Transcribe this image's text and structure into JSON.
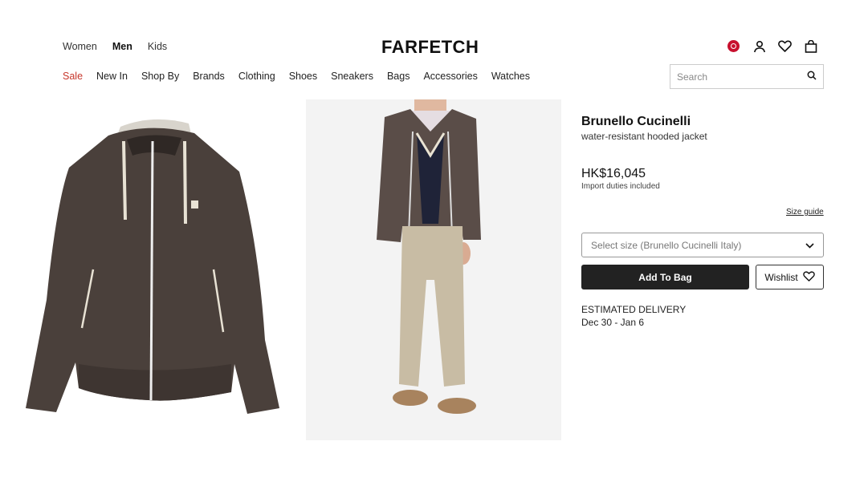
{
  "header": {
    "gender_tabs": [
      "Women",
      "Men",
      "Kids"
    ],
    "logo": "FARFETCH",
    "icons": [
      "region-flag-icon",
      "account-icon",
      "wishlist-heart-icon",
      "bag-icon"
    ]
  },
  "nav": {
    "items": [
      "Sale",
      "New In",
      "Shop By",
      "Brands",
      "Clothing",
      "Shoes",
      "Sneakers",
      "Bags",
      "Accessories",
      "Watches"
    ]
  },
  "search": {
    "placeholder": "Search"
  },
  "product": {
    "brand": "Brunello Cucinelli",
    "name": "water-resistant hooded jacket",
    "price": "HK$16,045",
    "duties": "Import duties included",
    "size_guide": "Size guide",
    "size_select": "Select size (Brunello Cucinelli Italy)",
    "add_to_bag": "Add To Bag",
    "wishlist": "Wishlist",
    "delivery_label": "ESTIMATED DELIVERY",
    "delivery_dates": "Dec 30 - Jan 6"
  },
  "colors": {
    "sale": "#c7362b",
    "button": "#222222",
    "jacket": "#4a403b"
  }
}
